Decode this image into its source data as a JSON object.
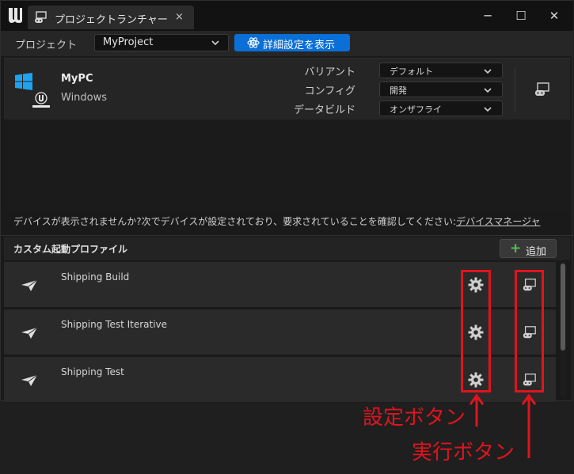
{
  "titlebar": {
    "tab_title": "プロジェクトランチャー",
    "close_glyph": "×",
    "minimize_glyph": "─",
    "maximize_glyph": "☐",
    "window_close_glyph": "✕"
  },
  "project_row": {
    "label": "プロジェクト",
    "selected_project": "MyProject",
    "advanced_button": "詳細設定を表示"
  },
  "device": {
    "name": "MyPC",
    "os": "Windows",
    "options": [
      {
        "label": "バリアント",
        "value": "デフォルト"
      },
      {
        "label": "コンフィグ",
        "value": "開発"
      },
      {
        "label": "データビルド",
        "value": "オンザフライ"
      }
    ]
  },
  "hint": {
    "text": "デバイスが表示されませんか?次でデバイスが設定されており、要求されていることを確認してください:",
    "link": "デバイスマネージャ"
  },
  "custom_profiles": {
    "title": "カスタム起動プロファイル",
    "add_label": "追加",
    "items": [
      {
        "name": "Shipping Build"
      },
      {
        "name": "Shipping Test Iterative"
      },
      {
        "name": "Shipping Test"
      }
    ]
  },
  "annotations": {
    "settings_label": "設定ボタン",
    "run_label": "実行ボタン",
    "color": "#e0141e"
  },
  "colors": {
    "accent_button": "#0a6fd6",
    "add_plus": "#4fc34f",
    "background": "#1a1a1a"
  }
}
